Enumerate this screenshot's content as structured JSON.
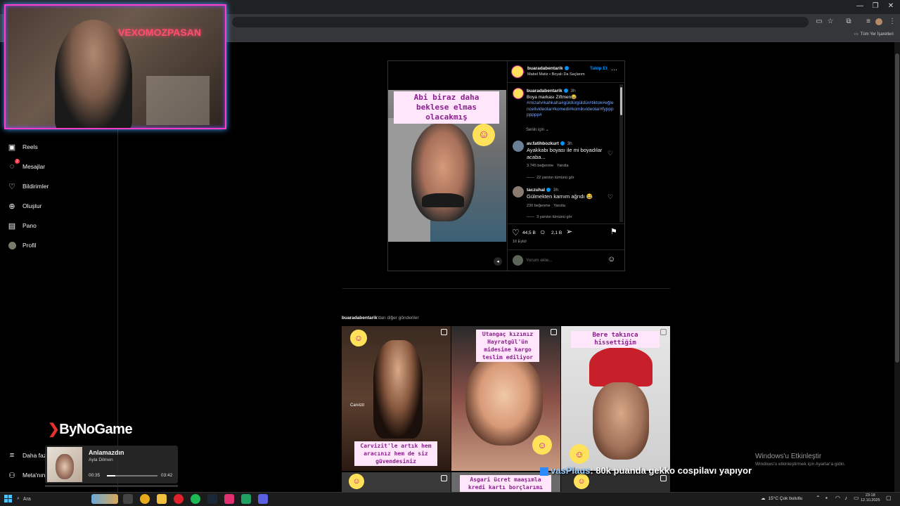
{
  "browser": {
    "bookmarks_all": "Tüm Yer İşaretleri",
    "window_controls": [
      "—",
      "❐",
      "✕"
    ]
  },
  "sidebar": {
    "items": [
      {
        "label": "Reels",
        "icon": "reels-icon"
      },
      {
        "label": "Mesajlar",
        "icon": "messenger-icon",
        "badge": "2"
      },
      {
        "label": "Bildirimler",
        "icon": "heart-icon"
      },
      {
        "label": "Oluştur",
        "icon": "plus-square-icon"
      },
      {
        "label": "Pano",
        "icon": "dashboard-icon"
      },
      {
        "label": "Profil",
        "icon": "avatar-icon"
      }
    ],
    "more_label": "Daha fazla",
    "meta_label": "Meta'nın"
  },
  "webcam": {
    "neon_text": "VEXOMOZPASAN"
  },
  "post": {
    "caption_overlay": "Abi biraz daha beklese elmas olacakmış",
    "header": {
      "username": "buaradabentarik",
      "follow_label": "Takip Et",
      "subline": "Mabel Matiz • Boyalı Da Saçlarım"
    },
    "caption": {
      "username": "buaradabentarik",
      "time": "3h",
      "text": "Boya markası Ziftmen😂",
      "hashtags": "#mizah#kahkaha#güldürgüldür#tiktok#eğlencelivideolar#komedi#komikvideolar#fypppppppp#"
    },
    "for_you_label": "Senin için",
    "comments": [
      {
        "username": "av.fatihbozkurt",
        "time": "3h",
        "text": "Ayakkabı boyası ile mi boyadılar acaba...",
        "likes": "3.745 beğenme",
        "reply": "Yanıtla",
        "view_replies": "22 yanıtın tümünü gör"
      },
      {
        "username": "taczuhal",
        "time": "3h",
        "text": "Gülmekten karnım ağrıdı 😂",
        "likes": "230 beğenme",
        "reply": "Yanıtla",
        "view_replies": "3 yanıtın tümünü gör"
      }
    ],
    "actions": {
      "likes": "44,5 B",
      "comments": "2,1 B"
    },
    "date": "16 Eylül",
    "comment_placeholder": "Yorum ekle..."
  },
  "more_posts": {
    "heading_user": "buaradabentarik",
    "heading_suffix": "'dan diğer gönderiler",
    "tiles": [
      {
        "caption": "Carvizit'le artık hem aracınız hem de siz güvendesiniz",
        "brand": "Carvizit"
      },
      {
        "caption": "Utangaç kızımız Hayratgül'ün midesine kargo teslim ediliyor"
      },
      {
        "caption": "Bere takınca hissettiğim"
      },
      {
        "caption": ""
      },
      {
        "caption": "Asgari ücret maaşımla kredi kartı borçlarımı kapatmaya"
      },
      {
        "caption": ""
      }
    ]
  },
  "overlay": {
    "brand": "ByNoGame",
    "music_title": "Anlamazdın",
    "music_artist": "Ayla Dilmen",
    "time_current": "00:35",
    "time_total": "03:42",
    "progress": 0.16,
    "chat_user": "vasPlaus",
    "chat_text": ": 80k puanda gekko cospilavı yapıyor"
  },
  "watermark": {
    "title": "Windows'u Etkinleştir",
    "subtitle": "Windows'u etkinleştirmek için Ayarlar'a gidin."
  },
  "taskbar": {
    "search_placeholder": "Ara",
    "weather": "15°C  Çok bulutlu",
    "time": "23:18",
    "date": "12.10.2025"
  }
}
